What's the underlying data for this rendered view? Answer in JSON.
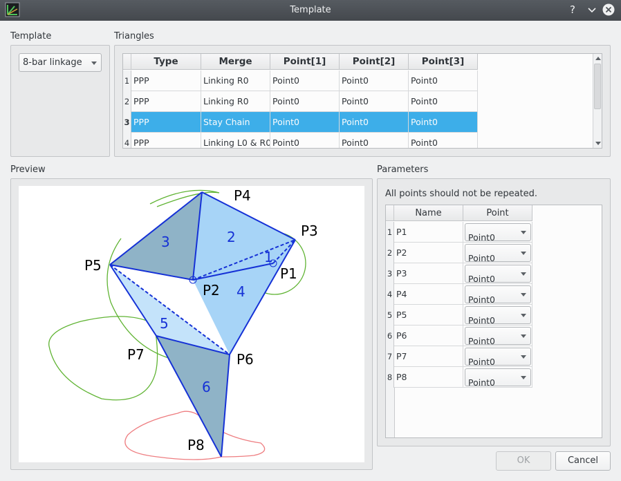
{
  "window": {
    "title": "Template",
    "help_glyph": "?"
  },
  "template_group": {
    "label": "Template",
    "combo_value": "8-bar linkage"
  },
  "triangles_group": {
    "label": "Triangles",
    "columns": [
      "Type",
      "Merge",
      "Point[1]",
      "Point[2]",
      "Point[3]"
    ],
    "rows": [
      {
        "num": "1",
        "cells": [
          "PPP",
          "Linking R0",
          "Point0",
          "Point0",
          "Point0"
        ]
      },
      {
        "num": "2",
        "cells": [
          "PPP",
          "Linking R0",
          "Point0",
          "Point0",
          "Point0"
        ]
      },
      {
        "num": "3",
        "cells": [
          "PPP",
          "Stay Chain",
          "Point0",
          "Point0",
          "Point0"
        ]
      },
      {
        "num": "4",
        "cells": [
          "PPP",
          "Linking L0 & R0",
          "Point0",
          "Point0",
          "Point0"
        ]
      }
    ],
    "selected_row": 3
  },
  "preview_group": {
    "label": "Preview",
    "point_labels": [
      "P1",
      "P2",
      "P3",
      "P4",
      "P5",
      "P6",
      "P7",
      "P8"
    ],
    "triangle_numbers": [
      "1",
      "2",
      "3",
      "4",
      "5",
      "6"
    ],
    "colors": {
      "link": "#1531d6",
      "fill_light": "#a7d4f7",
      "fill_dark": "#8fb3c7",
      "curve_green": "#5fb332",
      "curve_red": "#ee7d80"
    }
  },
  "parameters_group": {
    "label": "Parameters",
    "note": "All points should not be repeated.",
    "columns": [
      "Name",
      "Point"
    ],
    "rows": [
      {
        "num": "1",
        "name": "P1",
        "point": "Point0"
      },
      {
        "num": "2",
        "name": "P2",
        "point": "Point0"
      },
      {
        "num": "3",
        "name": "P3",
        "point": "Point0"
      },
      {
        "num": "4",
        "name": "P4",
        "point": "Point0"
      },
      {
        "num": "5",
        "name": "P5",
        "point": "Point0"
      },
      {
        "num": "6",
        "name": "P6",
        "point": "Point0"
      },
      {
        "num": "7",
        "name": "P7",
        "point": "Point0"
      },
      {
        "num": "8",
        "name": "P8",
        "point": "Point0"
      }
    ]
  },
  "buttons": {
    "ok": "OK",
    "cancel": "Cancel"
  },
  "theme": {
    "selection": "#3daee9",
    "window_bg": "#eff0f1",
    "titlebar": "#4d5257"
  }
}
